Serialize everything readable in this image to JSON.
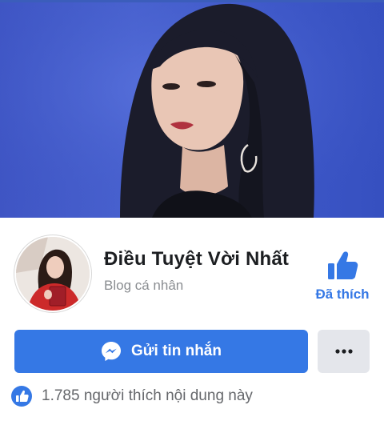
{
  "page": {
    "name": "Điều Tuyệt Vời Nhất",
    "category": "Blog cá nhân"
  },
  "actions": {
    "liked_label": "Đã thích",
    "message_label": "Gửi tin nhắn",
    "more_icon": "more-horizontal-icon"
  },
  "stats": {
    "likes_text": "1.785 người thích nội dung này"
  },
  "colors": {
    "accent": "#3578e5",
    "cover_blue": "#4a63d0",
    "secondary_button": "#e4e6eb"
  }
}
